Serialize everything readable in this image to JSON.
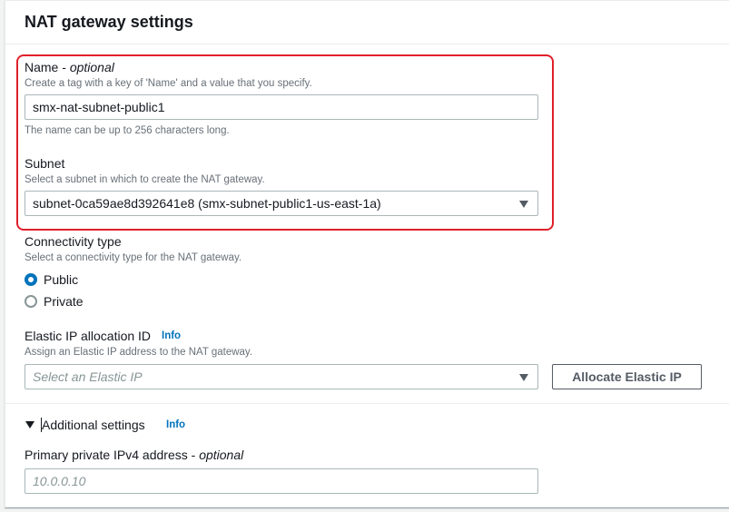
{
  "section": {
    "title": "NAT gateway settings"
  },
  "name_field": {
    "label": "Name",
    "label_suffix": " - ",
    "optional": "optional",
    "description": "Create a tag with a key of 'Name' and a value that you specify.",
    "value": "smx-nat-subnet-public1",
    "constraint": "The name can be up to 256 characters long."
  },
  "subnet_field": {
    "label": "Subnet",
    "description": "Select a subnet in which to create the NAT gateway.",
    "selected": "subnet-0ca59ae8d392641e8 (smx-subnet-public1-us-east-1a)"
  },
  "connectivity": {
    "label": "Connectivity type",
    "description": "Select a connectivity type for the NAT gateway.",
    "options": [
      {
        "label": "Public",
        "checked": true
      },
      {
        "label": "Private",
        "checked": false
      }
    ]
  },
  "elastic_ip": {
    "label": "Elastic IP allocation ID",
    "info": "Info",
    "description": "Assign an Elastic IP address to the NAT gateway.",
    "placeholder": "Select an Elastic IP",
    "allocate_button": "Allocate Elastic IP"
  },
  "additional": {
    "title": "Additional settings",
    "info": "Info",
    "expanded": true,
    "ipv4_label": "Primary private IPv4 address",
    "ipv4_suffix": " - ",
    "ipv4_optional": "optional",
    "ipv4_placeholder": "10.0.0.10"
  },
  "colors": {
    "highlight": "#e0202a",
    "link": "#0073bb",
    "radio_checked": "#0073bb"
  },
  "icons": [
    "chevron-down-icon",
    "expand-triangle-icon"
  ]
}
